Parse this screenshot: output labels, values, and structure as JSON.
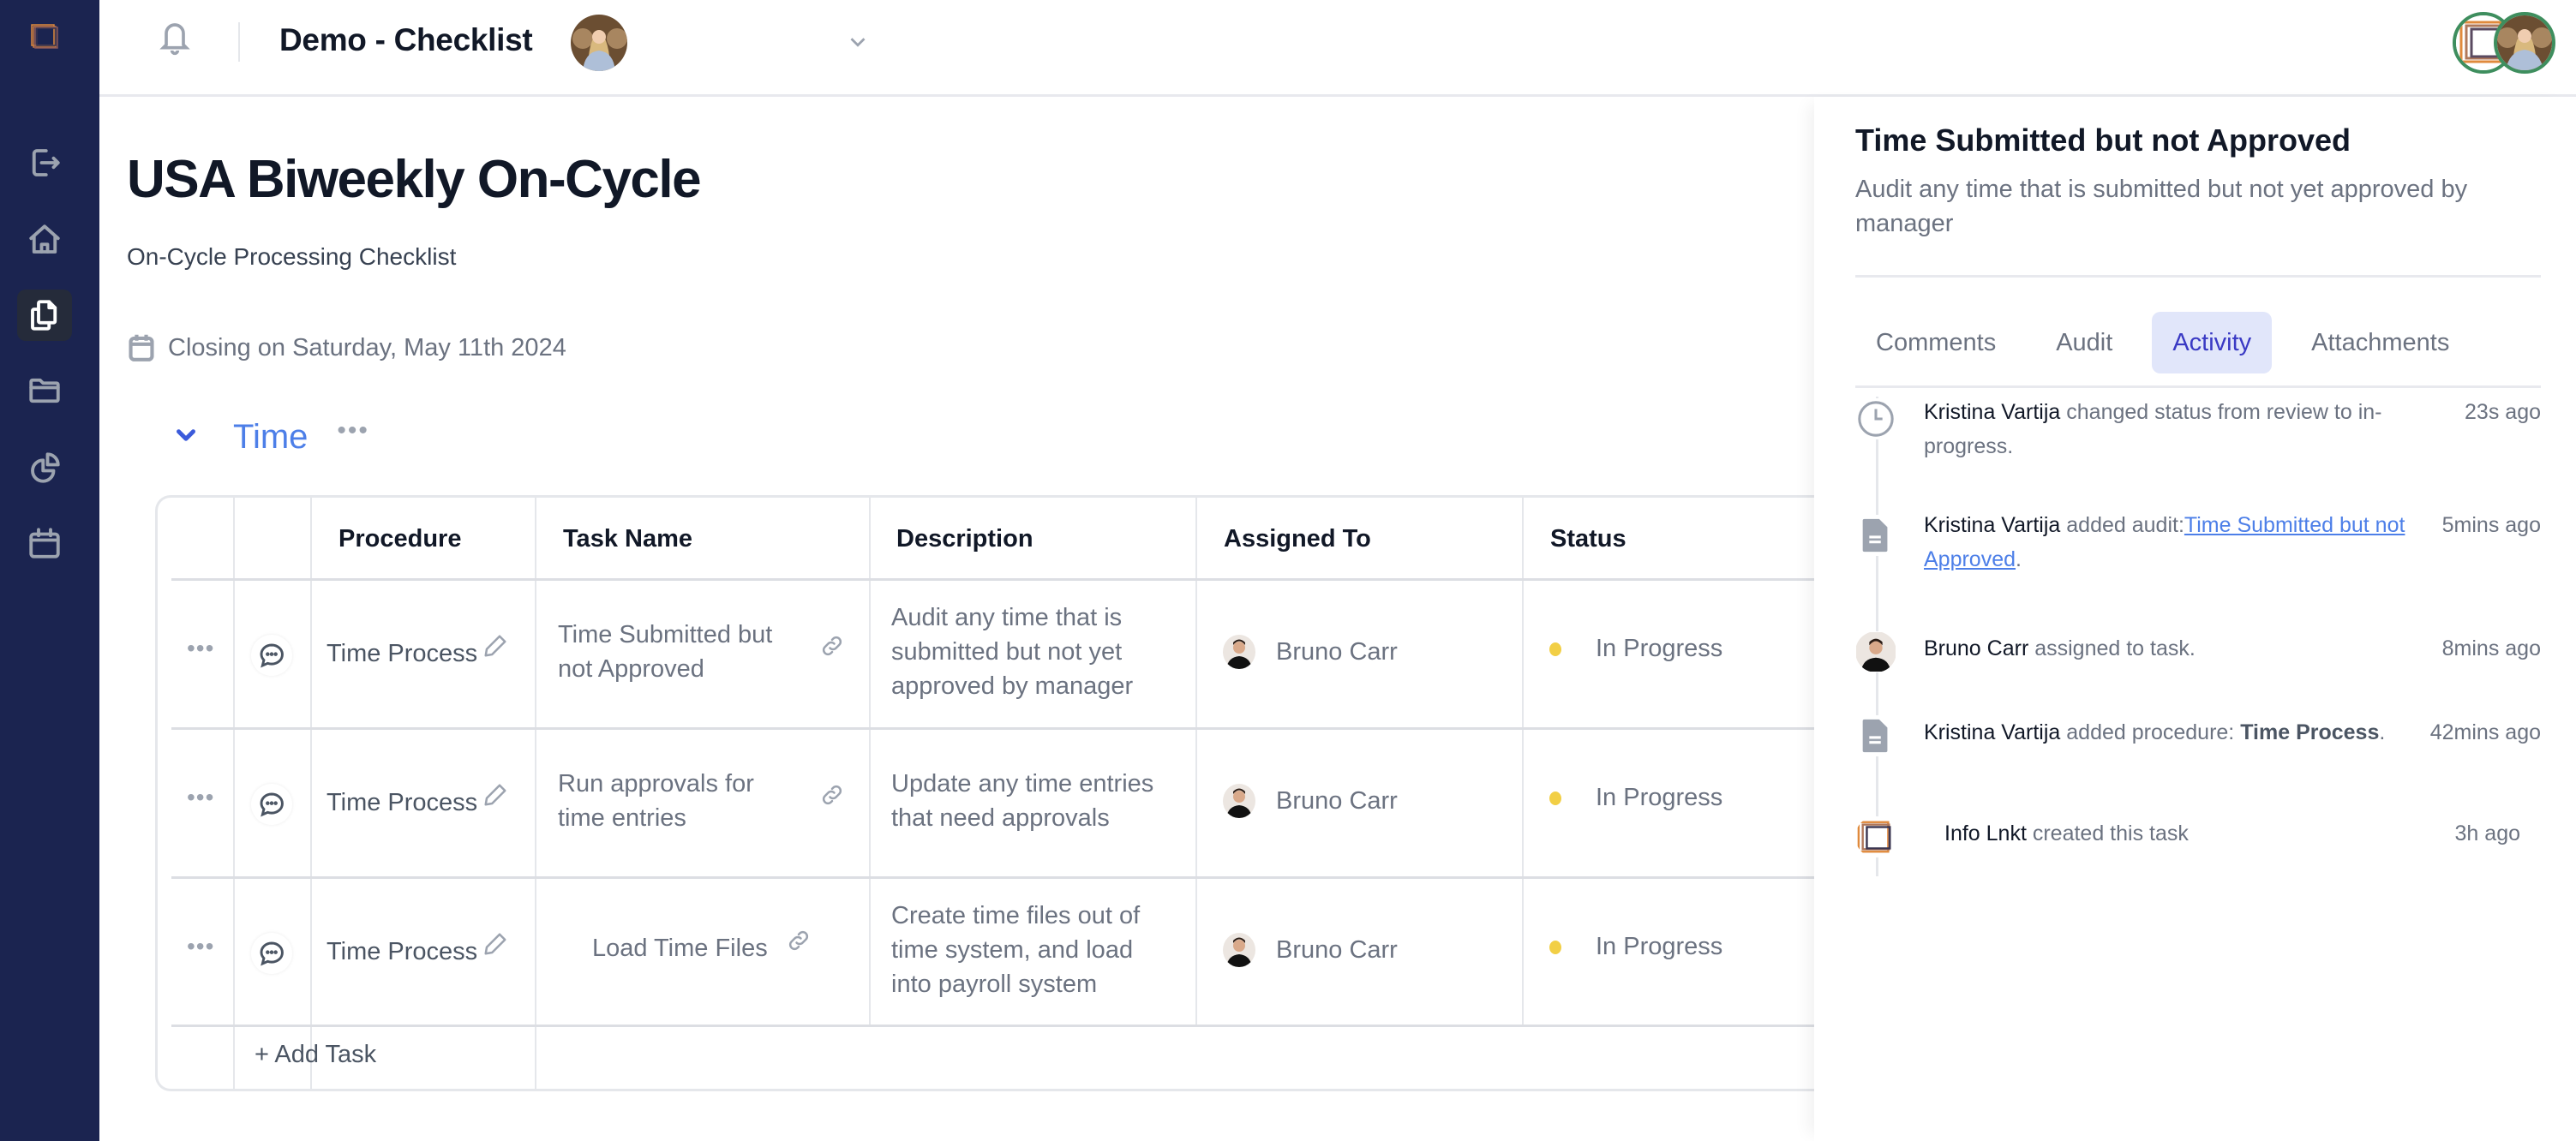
{
  "app": {
    "sidebar": {
      "items": [
        {
          "name": "logout",
          "icon": "logout-icon"
        },
        {
          "name": "home",
          "icon": "home-icon"
        },
        {
          "name": "checklists",
          "icon": "documents-icon",
          "active": true
        },
        {
          "name": "files",
          "icon": "folder-icon"
        },
        {
          "name": "reports",
          "icon": "pie-chart-icon"
        },
        {
          "name": "calendar",
          "icon": "calendar-icon"
        }
      ],
      "bg_color": "#1b2450"
    },
    "header": {
      "title": "Demo - Checklist"
    }
  },
  "page": {
    "title": "USA Biweekly On-Cycle",
    "subtitle": "On-Cycle Processing Checklist",
    "closing": "Closing on Saturday, May 11th 2024"
  },
  "section": {
    "title": "Time",
    "more": "•••"
  },
  "table": {
    "columns": [
      "Procedure",
      "Task Name",
      "Description",
      "Assigned To",
      "Status"
    ],
    "rows": [
      {
        "procedure": "Time Process",
        "task_name": "Time Submitted but not Approved",
        "task_line1": "Time Submitted but",
        "task_line2": "not Approved",
        "description_lines": [
          "Audit any time that is",
          "submitted but not yet",
          "approved by manager"
        ],
        "assigned_to": "Bruno Carr",
        "status": "In Progress"
      },
      {
        "procedure": "Time Process",
        "task_name": "Run approvals for time entries",
        "task_line1": "Run approvals for",
        "task_line2": "time entries",
        "description_lines": [
          "Update any time entries",
          "that need approvals"
        ],
        "assigned_to": "Bruno Carr",
        "status": "In Progress"
      },
      {
        "procedure": "Time Process",
        "task_name": "Load Time Files",
        "task_line1": "Load Time Files",
        "task_line2": "",
        "description_lines": [
          "Create time files out of",
          "time system, and load",
          "into payroll system"
        ],
        "assigned_to": "Bruno Carr",
        "status": "In Progress"
      }
    ],
    "add_task": "+ Add Task",
    "row_more": "•••",
    "status_color": "#f2cf45"
  },
  "panel": {
    "title": "Time Submitted but not Approved",
    "description": "Audit any time that is submitted but not yet approved by manager",
    "tabs": [
      "Comments",
      "Audit",
      "Activity",
      "Attachments"
    ],
    "active_tab": "Activity",
    "activity": [
      {
        "icon": "clock-icon",
        "who": "Kristina Vartija",
        "text": " changed status from review to in-progress.",
        "time": "23s ago"
      },
      {
        "icon": "document-icon",
        "who": "Kristina Vartija",
        "text": " added audit:",
        "link": "Time Submitted but not Approved",
        "after": ".",
        "time": "5mins ago"
      },
      {
        "icon": "avatar",
        "who": "Bruno Carr",
        "text": " assigned to task.",
        "time": "8mins ago"
      },
      {
        "icon": "document-icon",
        "who": "Kristina Vartija",
        "text": " added procedure: ",
        "bold": "Time Process",
        "after": ".",
        "time": "42mins ago"
      },
      {
        "icon": "logo-avatar",
        "who": "Info Lnkt",
        "text": " created this task",
        "time": "3h ago"
      }
    ]
  }
}
